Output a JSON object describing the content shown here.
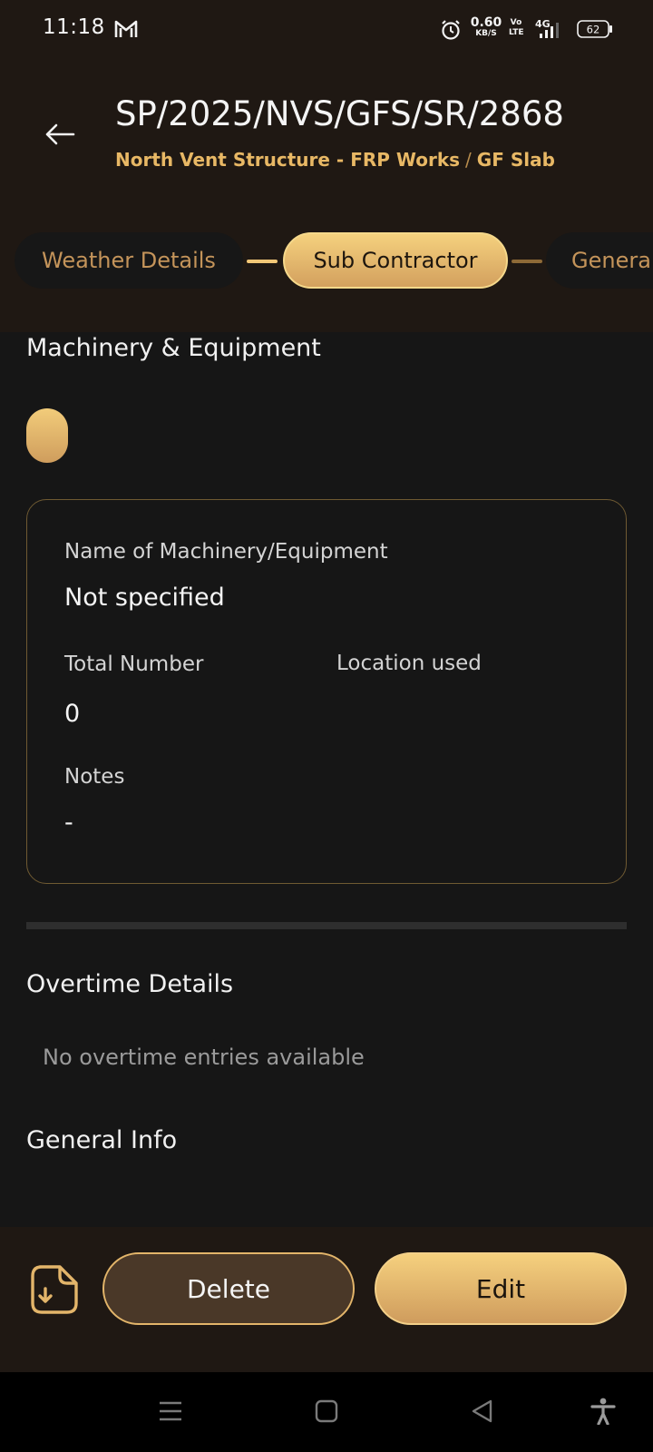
{
  "status_bar": {
    "time": "11:18",
    "net_speed_value": "0.60",
    "net_speed_unit": "KB/S",
    "volte_top": "Vo",
    "volte_bottom": "LTE",
    "network_type": "4G",
    "battery_level": "62",
    "icons": [
      "gmail-icon",
      "alarm-icon",
      "signal-icon",
      "battery-icon"
    ]
  },
  "header": {
    "title": "SP/2025/NVS/GFS/SR/2868",
    "project": "North Vent Structure - FRP Works",
    "separator": "/",
    "location": "GF Slab",
    "back_icon": "arrow-left-icon"
  },
  "stepper": {
    "steps": [
      {
        "label": "Weather Details",
        "state": "inactive"
      },
      {
        "label": "Sub Contractor",
        "state": "active"
      },
      {
        "label": "Genera",
        "state": "inactive"
      }
    ]
  },
  "machinery": {
    "section_title": "Machinery & Equipment",
    "card": {
      "name_label": "Name of Machinery/Equipment",
      "name_value": "Not specified",
      "total_label": "Total Number",
      "total_value": "0",
      "location_label": "Location used",
      "location_value": "",
      "notes_label": "Notes",
      "notes_value": "-"
    }
  },
  "overtime": {
    "section_title": "Overtime Details",
    "empty_text": "No overtime entries available"
  },
  "general_info": {
    "section_title": "General Info"
  },
  "actions": {
    "download_icon": "download-document-icon",
    "delete_label": "Delete",
    "edit_label": "Edit"
  },
  "colors": {
    "accent": "#e8b865",
    "header_bg": "#1f1813",
    "body_bg": "#161616"
  }
}
